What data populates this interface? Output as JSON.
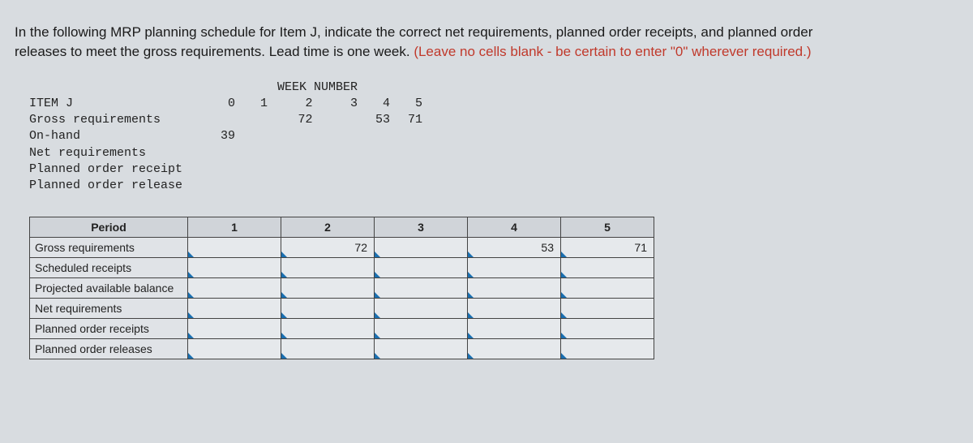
{
  "prompt": {
    "line1": "In the following MRP planning schedule for Item J, indicate the correct net requirements, planned order receipts, and planned order",
    "line2a": "releases to meet the gross requirements. Lead time is one week. ",
    "line2b": "(Leave no cells blank - be certain to enter \"0\" wherever required.)"
  },
  "mono": {
    "header": "WEEK NUMBER",
    "item_label": "ITEM J",
    "cols": [
      "0",
      "1",
      "2",
      "3",
      "4",
      "5"
    ],
    "rows": [
      {
        "label": "Gross requirements",
        "vals": [
          "",
          "",
          "72",
          "",
          "53",
          "71"
        ]
      },
      {
        "label": "On-hand",
        "vals": [
          "39",
          "",
          "",
          "",
          "",
          ""
        ]
      },
      {
        "label": "Net requirements",
        "vals": [
          "",
          "",
          "",
          "",
          "",
          ""
        ]
      },
      {
        "label": "Planned order receipt",
        "vals": [
          "",
          "",
          "",
          "",
          "",
          ""
        ]
      },
      {
        "label": "Planned order release",
        "vals": [
          "",
          "",
          "",
          "",
          "",
          ""
        ]
      }
    ]
  },
  "answer": {
    "period_label": "Period",
    "cols": [
      "1",
      "2",
      "3",
      "4",
      "5"
    ],
    "rows": [
      {
        "label": "Gross requirements",
        "vals": [
          "",
          "72",
          "",
          "53",
          "71"
        ]
      },
      {
        "label": "Scheduled receipts",
        "vals": [
          "",
          "",
          "",
          "",
          ""
        ]
      },
      {
        "label": "Projected available balance",
        "vals": [
          "",
          "",
          "",
          "",
          ""
        ]
      },
      {
        "label": "Net requirements",
        "vals": [
          "",
          "",
          "",
          "",
          ""
        ]
      },
      {
        "label": "Planned order receipts",
        "vals": [
          "",
          "",
          "",
          "",
          ""
        ]
      },
      {
        "label": "Planned order releases",
        "vals": [
          "",
          "",
          "",
          "",
          ""
        ]
      }
    ]
  }
}
